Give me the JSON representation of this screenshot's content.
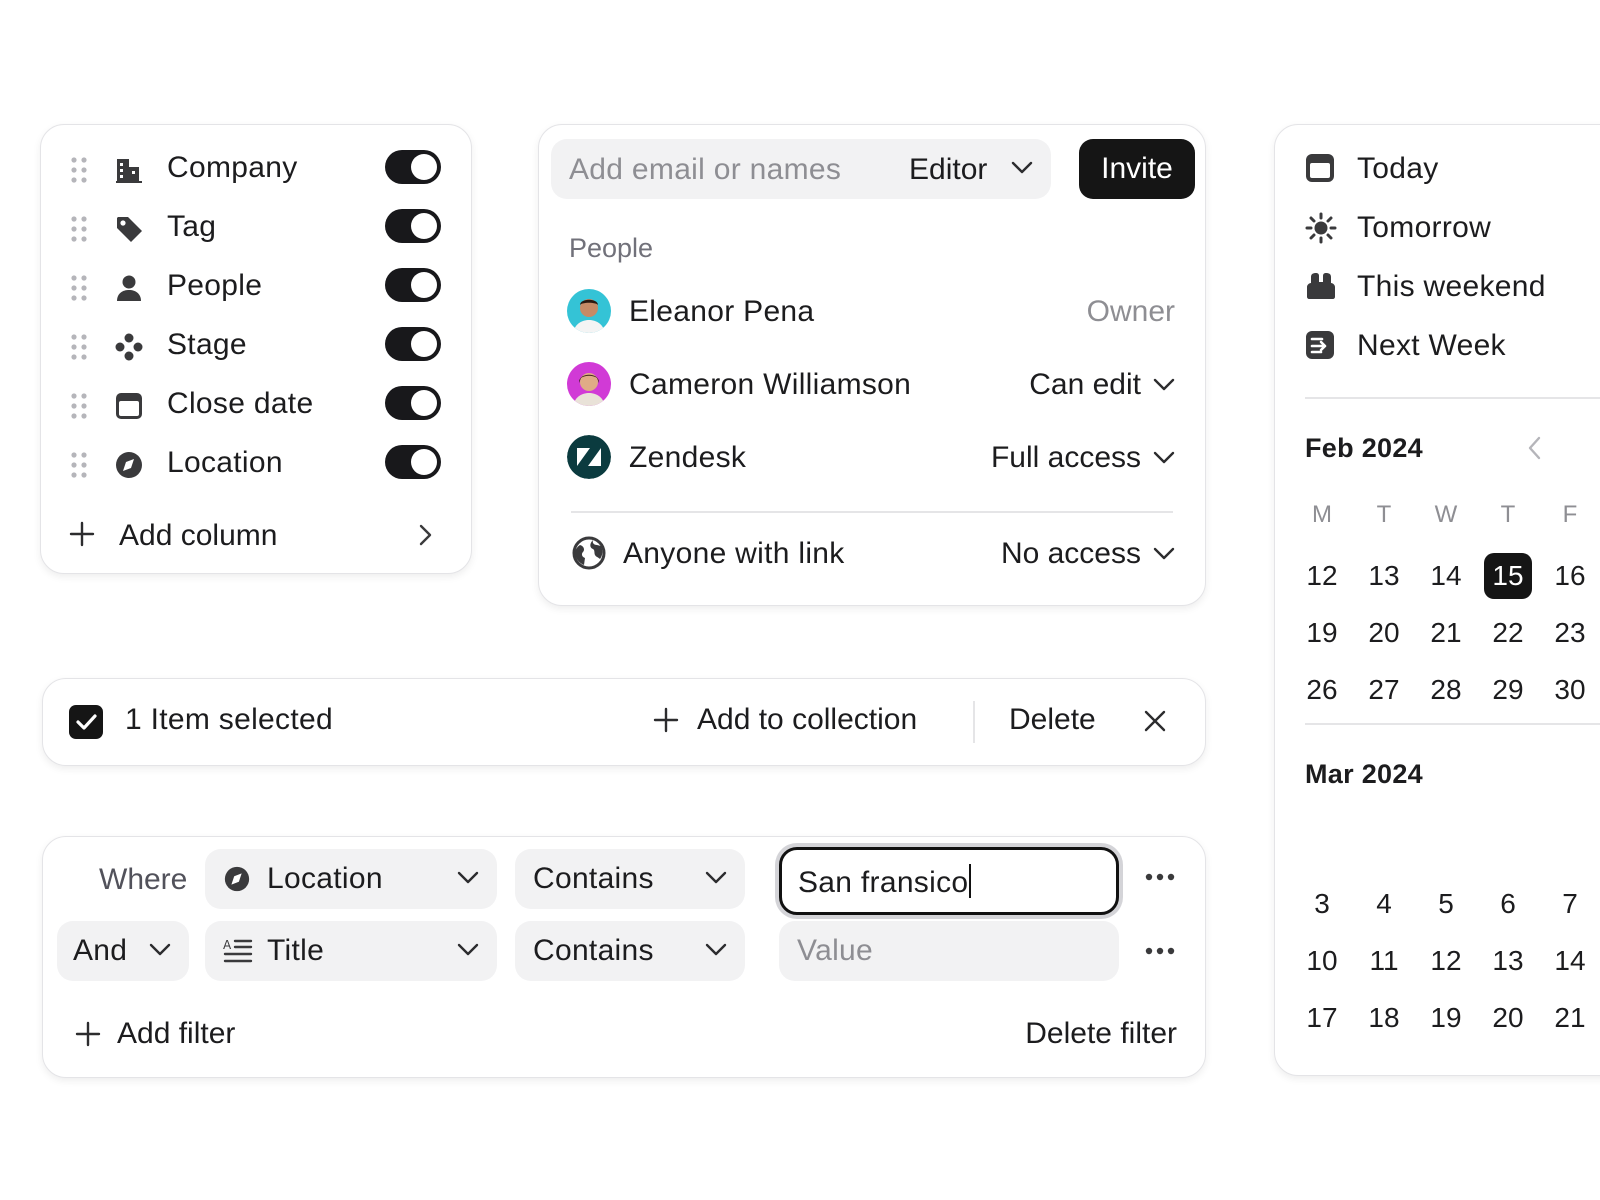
{
  "columns": {
    "items": [
      {
        "label": "Company",
        "icon": "building-icon"
      },
      {
        "label": "Tag",
        "icon": "tag-icon"
      },
      {
        "label": "People",
        "icon": "person-icon"
      },
      {
        "label": "Stage",
        "icon": "stage-icon"
      },
      {
        "label": "Close date",
        "icon": "calendar-icon"
      },
      {
        "label": "Location",
        "icon": "compass-icon"
      }
    ],
    "add_label": "Add column"
  },
  "share": {
    "input_placeholder": "Add email or names",
    "role": "Editor",
    "invite_label": "Invite",
    "section_label": "People",
    "people": [
      {
        "name": "Eleanor Pena",
        "permission": "Owner"
      },
      {
        "name": "Cameron Williamson",
        "permission": "Can edit"
      },
      {
        "name": "Zendesk",
        "permission": "Full access"
      }
    ],
    "link": {
      "label": "Anyone with link",
      "permission": "No access"
    }
  },
  "calendar": {
    "quick": [
      {
        "label": "Today",
        "icon": "calendar-today-icon"
      },
      {
        "label": "Tomorrow",
        "icon": "sun-icon"
      },
      {
        "label": "This weekend",
        "icon": "sofa-icon"
      },
      {
        "label": "Next Week",
        "icon": "calendar-arrow-icon"
      }
    ],
    "weekdays": [
      "M",
      "T",
      "W",
      "T",
      "F"
    ],
    "months": [
      {
        "title": "Feb 2024",
        "weeks": [
          [
            "12",
            "13",
            "14",
            "15",
            "16"
          ],
          [
            "19",
            "20",
            "21",
            "22",
            "23"
          ],
          [
            "26",
            "27",
            "28",
            "29",
            "30"
          ]
        ],
        "selected": "15"
      },
      {
        "title": "Mar 2024",
        "weeks": [
          [
            "3",
            "4",
            "5",
            "6",
            "7"
          ],
          [
            "10",
            "11",
            "12",
            "13",
            "14"
          ],
          [
            "17",
            "18",
            "19",
            "20",
            "21"
          ]
        ]
      }
    ]
  },
  "selection": {
    "text": "1 Item selected",
    "add_label": "Add to collection",
    "delete_label": "Delete"
  },
  "filter": {
    "where_label": "Where",
    "rows": [
      {
        "field": "Location",
        "operator": "Contains",
        "value": "San fransico"
      },
      {
        "conjunction": "And",
        "field": "Title",
        "operator": "Contains",
        "value_placeholder": "Value"
      }
    ],
    "add_label": "Add filter",
    "delete_label": "Delete filter"
  },
  "colors": {
    "accent": "#151515",
    "muted": "#8e8e93",
    "pill_bg": "#f2f2f3"
  }
}
